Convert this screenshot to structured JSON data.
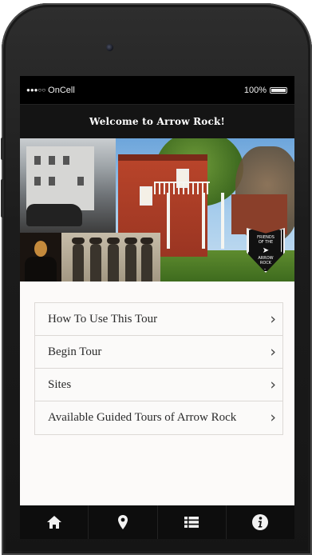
{
  "status": {
    "carrier": "OnCell",
    "battery": "100%"
  },
  "header": {
    "title": "Welcome to Arrow Rock!"
  },
  "hero": {
    "badge_lines": [
      "FRIENDS",
      "OF THE",
      "ARROW",
      "ROCK"
    ]
  },
  "menu": {
    "items": [
      {
        "label": "How To Use This Tour"
      },
      {
        "label": "Begin Tour"
      },
      {
        "label": "Sites"
      },
      {
        "label": "Available Guided Tours of Arrow Rock"
      }
    ],
    "chevron": "›"
  },
  "tabbar": {
    "tabs": [
      {
        "icon": "home-icon"
      },
      {
        "icon": "map-pin-icon"
      },
      {
        "icon": "list-icon"
      },
      {
        "icon": "info-icon"
      }
    ]
  },
  "colors": {
    "screen_bg": "#fcfaf9",
    "bar_bg": "#141414",
    "menu_text": "#2b2b2b"
  }
}
